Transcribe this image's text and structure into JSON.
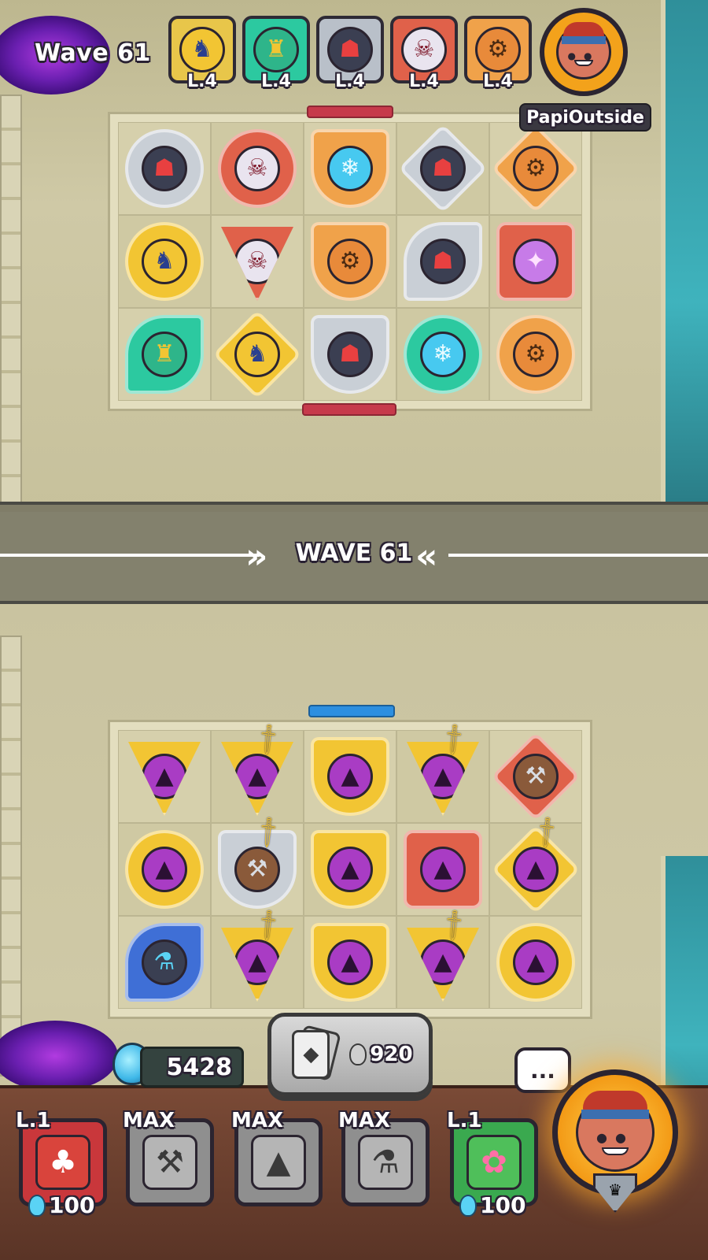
{
  "opponent": {
    "wave_label": "Wave 61",
    "name": "PapiOutside",
    "deck": [
      {
        "level": "L.4",
        "unit": "golden-knight",
        "frame_color": "#e8c64a"
      },
      {
        "level": "L.4",
        "unit": "green-paladin",
        "frame_color": "#2cc9a0"
      },
      {
        "level": "L.4",
        "unit": "hooded-reaper",
        "frame_color": "#b9c0c9"
      },
      {
        "level": "L.4",
        "unit": "vampire",
        "frame_color": "#e0614a"
      },
      {
        "level": "L.4",
        "unit": "goggled-engineer",
        "frame_color": "#f0a24a"
      }
    ],
    "board": [
      {
        "unit": "hooded-reaper",
        "shape": "circle",
        "color": "#c9cfd6"
      },
      {
        "unit": "vampire",
        "shape": "circle",
        "color": "#e0614a"
      },
      {
        "unit": "ice-crystal-golem",
        "shape": "shield",
        "color": "#f0a24a"
      },
      {
        "unit": "hooded-reaper",
        "shape": "diamond",
        "color": "#c9cfd6"
      },
      {
        "unit": "goggled-engineer",
        "shape": "diamond",
        "color": "#f0a24a"
      },
      {
        "unit": "golden-knight",
        "shape": "circle",
        "color": "#f2c533"
      },
      {
        "unit": "vampire",
        "shape": "tri",
        "color": "#e0614a"
      },
      {
        "unit": "goggled-engineer",
        "shape": "shield",
        "color": "#f0a24a"
      },
      {
        "unit": "hooded-reaper",
        "shape": "leaf",
        "color": "#c9cfd6"
      },
      {
        "unit": "crystal-golem-pink",
        "shape": "square",
        "color": "#e0614a"
      },
      {
        "unit": "green-paladin",
        "shape": "leaf",
        "color": "#2cc9a0"
      },
      {
        "unit": "golden-knight",
        "shape": "diamond",
        "color": "#f2c533"
      },
      {
        "unit": "hooded-reaper",
        "shape": "shield",
        "color": "#c9cfd6"
      },
      {
        "unit": "ice-crystal-golem",
        "shape": "circle",
        "color": "#2cc9a0"
      },
      {
        "unit": "goggled-engineer",
        "shape": "circle",
        "color": "#f0a24a"
      }
    ]
  },
  "divider": {
    "wave_label": "WAVE 61"
  },
  "player": {
    "mana": "5428",
    "summon_cost": "920",
    "emote_label": "...",
    "board": [
      {
        "unit": "purple-wizard",
        "shape": "tri",
        "color": "#f2c533",
        "buff": ""
      },
      {
        "unit": "purple-wizard",
        "shape": "tri",
        "color": "#f2c533",
        "buff": "sword"
      },
      {
        "unit": "purple-wizard",
        "shape": "shield",
        "color": "#f2c533",
        "buff": ""
      },
      {
        "unit": "purple-wizard",
        "shape": "tri",
        "color": "#f2c533",
        "buff": "sword"
      },
      {
        "unit": "armored-cannon",
        "shape": "diamond",
        "color": "#e0614a",
        "buff": ""
      },
      {
        "unit": "purple-wizard",
        "shape": "circle",
        "color": "#f2c533",
        "buff": ""
      },
      {
        "unit": "armored-cannon",
        "shape": "shield",
        "color": "#c9cfd6",
        "buff": "sword"
      },
      {
        "unit": "purple-wizard",
        "shape": "shield",
        "color": "#f2c533",
        "buff": ""
      },
      {
        "unit": "purple-wizard",
        "shape": "square",
        "color": "#e0614a",
        "buff": ""
      },
      {
        "unit": "purple-wizard",
        "shape": "diamond",
        "color": "#f2c533",
        "buff": "sword"
      },
      {
        "unit": "blue-cauldron",
        "shape": "leaf",
        "color": "#3f6fd6",
        "buff": ""
      },
      {
        "unit": "purple-wizard",
        "shape": "tri",
        "color": "#f2c533",
        "buff": "sword"
      },
      {
        "unit": "purple-wizard",
        "shape": "shield",
        "color": "#f2c533",
        "buff": ""
      },
      {
        "unit": "purple-wizard",
        "shape": "tri",
        "color": "#f2c533",
        "buff": "sword"
      },
      {
        "unit": "purple-wizard",
        "shape": "circle",
        "color": "#f2c533",
        "buff": ""
      }
    ],
    "hand": [
      {
        "level": "L.1",
        "cost": "100",
        "unit": "jester",
        "frame_color": "#c9373b"
      },
      {
        "level": "MAX",
        "cost": "",
        "unit": "armored-cannon",
        "frame_color": "#8f8f8f"
      },
      {
        "level": "MAX",
        "cost": "",
        "unit": "purple-wizard",
        "frame_color": "#8f8f8f"
      },
      {
        "level": "MAX",
        "cost": "",
        "unit": "blue-cauldron",
        "frame_color": "#8f8f8f"
      },
      {
        "level": "L.1",
        "cost": "100",
        "unit": "dryad",
        "frame_color": "#3aa94f"
      }
    ]
  },
  "colors": {
    "portal": "#6a1fb0",
    "mana": "#5ad3f5",
    "opponent_avatar_bg": "#f3a21b",
    "player_avatar_glow": "#ff9a1a"
  }
}
